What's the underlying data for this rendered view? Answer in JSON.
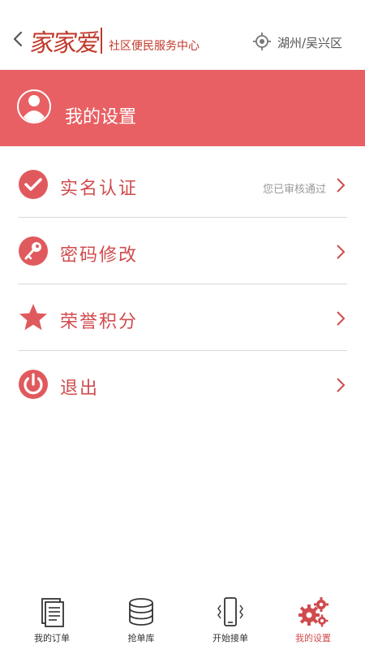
{
  "header": {
    "logo": "家家爱",
    "subtitle": "社区便民服务中心",
    "location": "湖州/吴兴区"
  },
  "banner": {
    "title": "我的设置"
  },
  "menu": {
    "items": [
      {
        "label": "实名认证",
        "status": "您已审核通过",
        "icon": "check-circle-icon"
      },
      {
        "label": "密码修改",
        "status": "",
        "icon": "key-icon"
      },
      {
        "label": "荣誉积分",
        "status": "",
        "icon": "star-icon"
      },
      {
        "label": "退出",
        "status": "",
        "icon": "power-icon"
      }
    ]
  },
  "tabs": [
    {
      "label": "我的订单",
      "icon": "document-icon"
    },
    {
      "label": "抢单库",
      "icon": "database-icon"
    },
    {
      "label": "开始接单",
      "icon": "phone-vibrate-icon"
    },
    {
      "label": "我的设置",
      "icon": "gears-icon",
      "active": true
    }
  ],
  "colors": {
    "accent": "#e86063",
    "accent_dark": "#d04b4e"
  }
}
